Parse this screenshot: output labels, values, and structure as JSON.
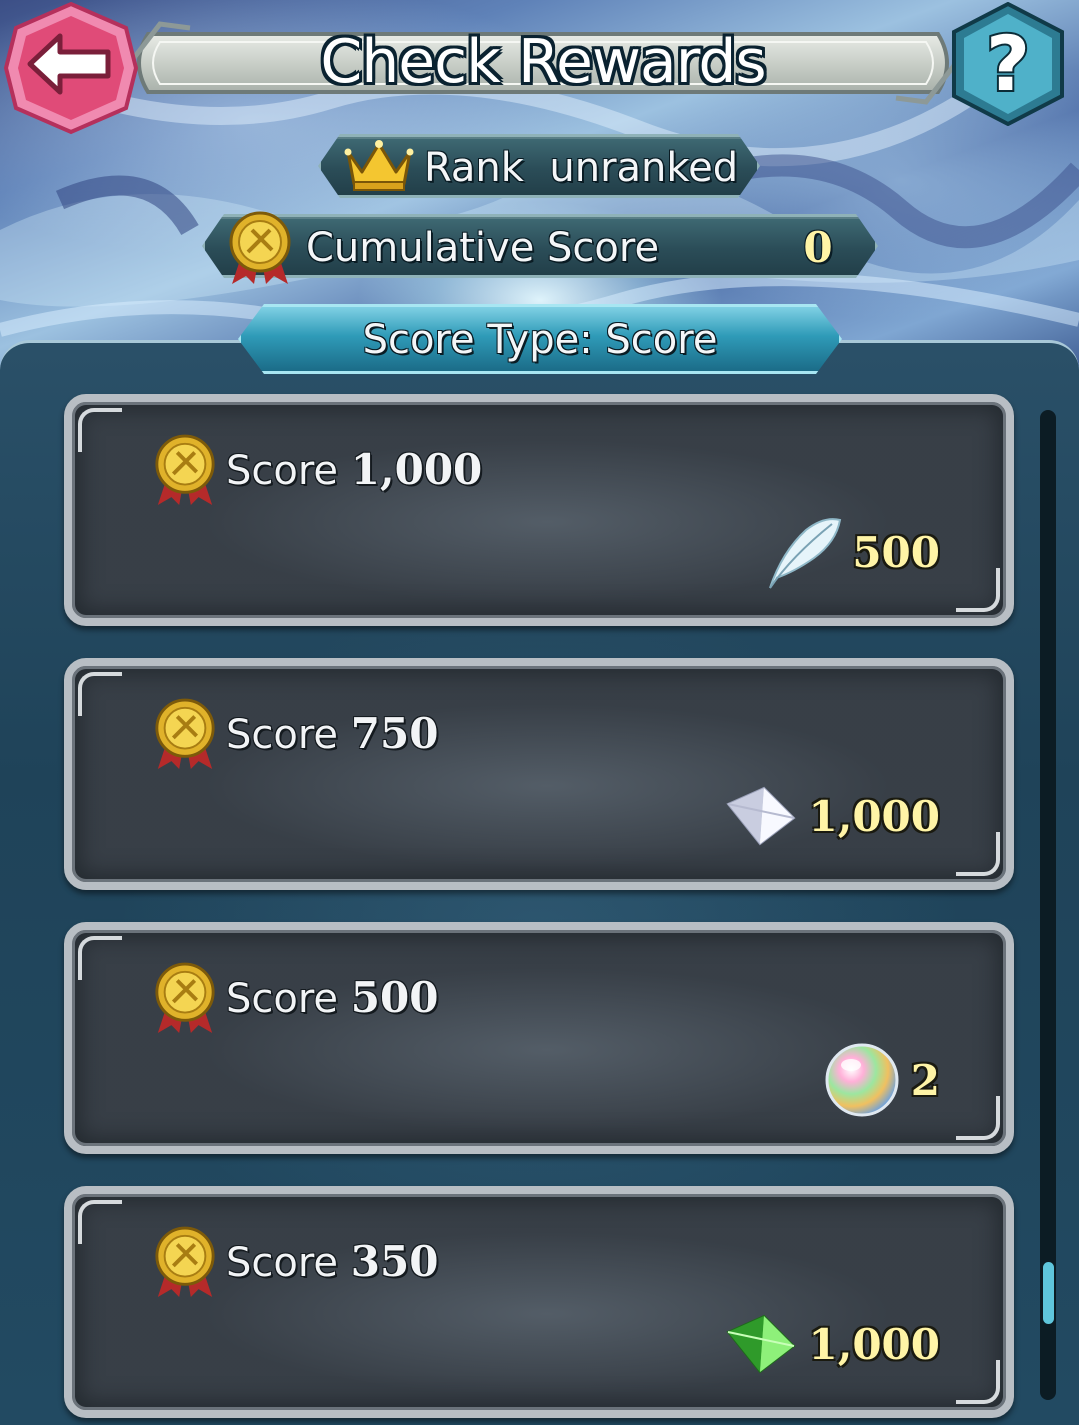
{
  "header": {
    "title": "Check Rewards",
    "back_icon": "back-arrow-icon",
    "help_label": "?"
  },
  "rank": {
    "icon": "crown-icon",
    "text": "Rank  unranked"
  },
  "cumulative": {
    "icon": "score-medal-icon",
    "label": "Cumulative Score",
    "value": "0"
  },
  "score_type": {
    "label": "Score Type: Score"
  },
  "rewards": [
    {
      "label": "Score",
      "threshold": "1,000",
      "reward_icon": "feather-icon",
      "reward_amount": "500"
    },
    {
      "label": "Score",
      "threshold": "750",
      "reward_icon": "divine-dew-crystal-icon",
      "reward_amount": "1,000"
    },
    {
      "label": "Score",
      "threshold": "500",
      "reward_icon": "orb-icon",
      "reward_amount": "2"
    },
    {
      "label": "Score",
      "threshold": "350",
      "reward_icon": "green-crystal-icon",
      "reward_amount": "1,000"
    }
  ],
  "colors": {
    "accent_gold": "#fff4a6",
    "back_button": "#e4507a",
    "help_button": "#3c9cb4",
    "score_type_bar": "#2f9bb8"
  }
}
